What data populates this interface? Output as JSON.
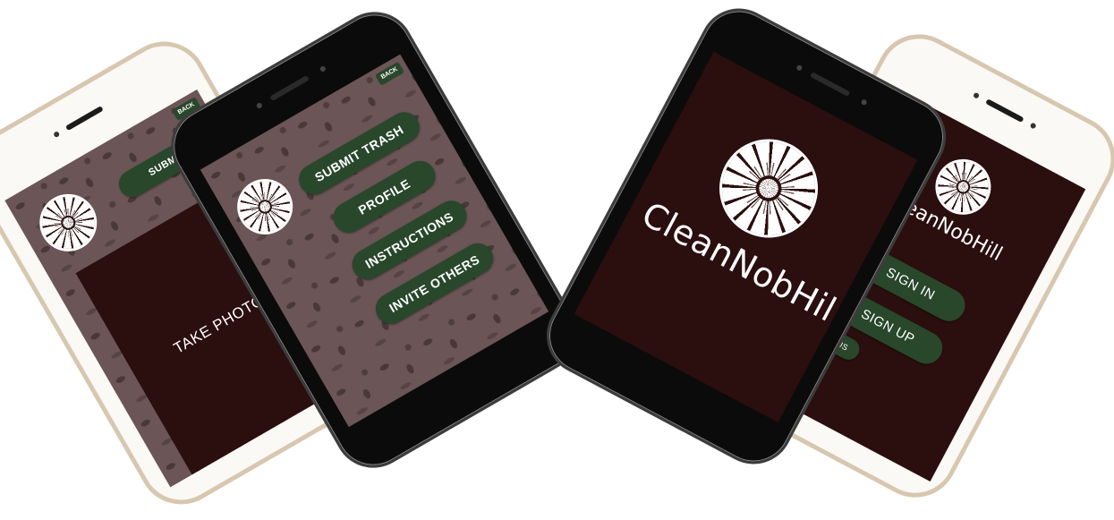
{
  "colors": {
    "button_green": "#28472b",
    "dark_maroon": "#2b0e0e",
    "pattern_mauve": "#6b5556",
    "white_phone_frame": "#d8c7b0",
    "black_phone_frame": "#0b0b0b"
  },
  "phone1": {
    "back_label": "BACK",
    "submit_label": "SUBMIT T",
    "take_photo_label": "TAKE PHOTO",
    "logo_icon": "rose-window-icon"
  },
  "phone2": {
    "back_label": "BACK",
    "menu": [
      {
        "label": "SUBMIT TRASH"
      },
      {
        "label": "PROFILE"
      },
      {
        "label": "INSTRUCTIONS"
      },
      {
        "label": "INVITE OTHERS"
      }
    ],
    "logo_icon": "rose-window-icon"
  },
  "phone3": {
    "brand": "CleanNobHill",
    "logo_icon": "rose-window-icon"
  },
  "phone4": {
    "brand": "CleanNobHill",
    "sign_in_label": "SIGN IN",
    "sign_up_label": "SIGN UP",
    "about_label": "ABOUT US",
    "logo_icon": "rose-window-icon"
  }
}
